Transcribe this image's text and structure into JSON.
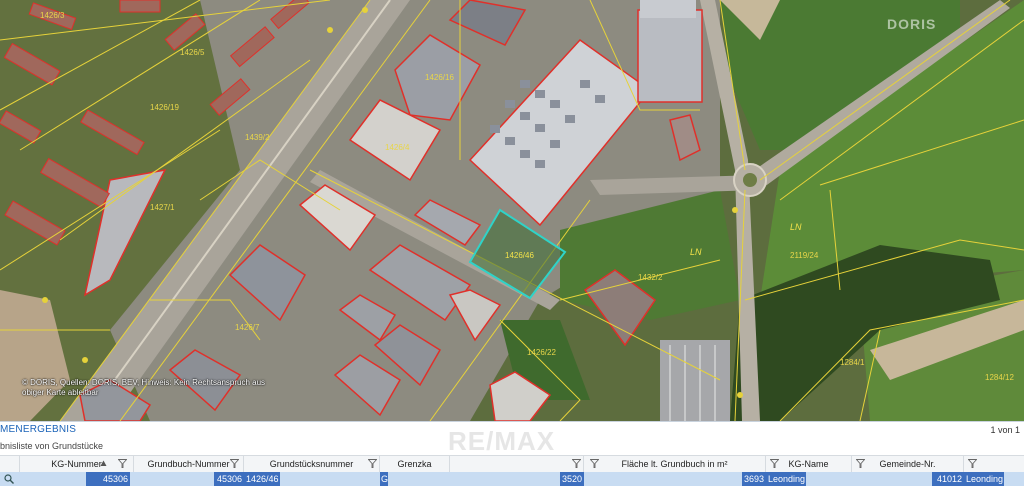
{
  "map": {
    "copyright": "© DORIS, Quellen: DORIS, BEV, Hinweis: Kein Rechtsanspruch aus obiger Karte ableitbar",
    "logo_text": "DORIS",
    "selected_parcel_label": "1426/46",
    "field_labels": [
      "LN",
      "LN",
      "2119/24"
    ],
    "parcel_labels": [
      "1426/3",
      "1426/5",
      "1439/2",
      "1427/1",
      "1426/16",
      "1426/4",
      "1432/2",
      "1426/22",
      "1426/7",
      "1284/12",
      "1284/1",
      "1426/19"
    ],
    "colors": {
      "parcel_line": "#e6d23a",
      "selected_parcel": "#2fd3c8",
      "building_outline": "#e0302a",
      "road": "#b9b4aa"
    }
  },
  "panel": {
    "title": "MENERGEBNIS",
    "subtitle": "bnisliste von Grundstücke",
    "pagination": "1 von 1",
    "watermark": "RE/MAX",
    "columns": [
      {
        "label": "KG-Nummer"
      },
      {
        "label": "Grundbuch-Nummer"
      },
      {
        "label": "Grundstücksnummer"
      },
      {
        "label": "Grenzka"
      },
      {
        "label": ""
      },
      {
        "label": "Fläche lt. Grundbuch in m²"
      },
      {
        "label": "KG-Name"
      },
      {
        "label": "Gemeinde-Nr."
      }
    ],
    "row": {
      "kg_nummer": "45306",
      "grundbuch_nummer": "45306",
      "grundstuecksnummer": "1426/46",
      "grenzkataster": "G",
      "col5": "3520",
      "flaeche": "3693",
      "kg_name": "Leonding",
      "gemeinde_nr": "41012",
      "last": "Leonding"
    }
  }
}
